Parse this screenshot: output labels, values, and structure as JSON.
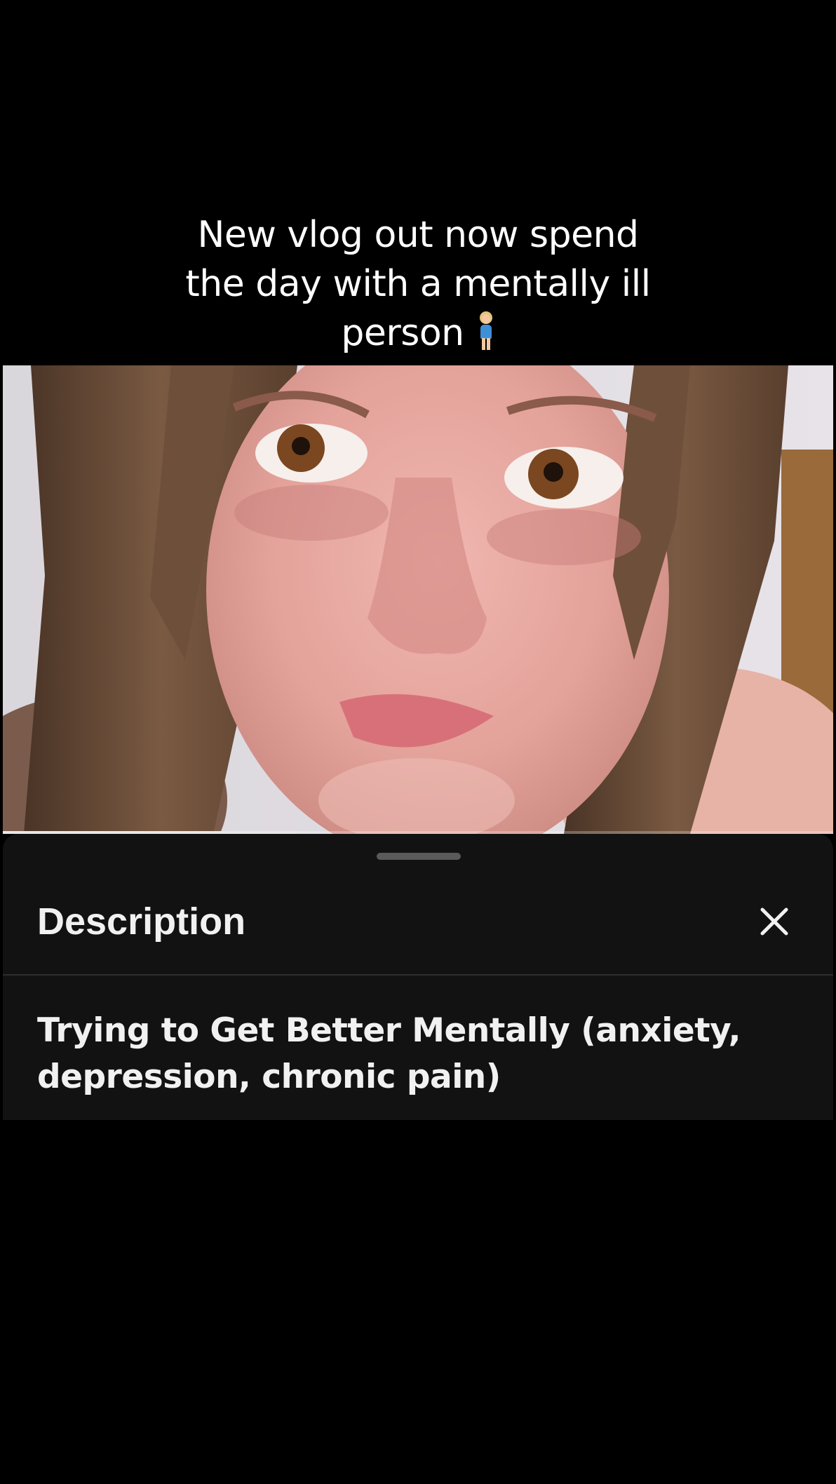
{
  "caption": {
    "lines": [
      "New vlog out now spend",
      "the day with a mentally ill",
      "person"
    ],
    "emoji": "woman-standing"
  },
  "video": {
    "progress": 0.355
  },
  "description_sheet": {
    "title": "Description",
    "close_icon": "close-icon",
    "text": "Trying to Get Better Mentally (anxiety, depression, chronic pain)"
  },
  "colors": {
    "background": "#000000",
    "sheet": "#121212",
    "text": "#f1f1f1"
  }
}
